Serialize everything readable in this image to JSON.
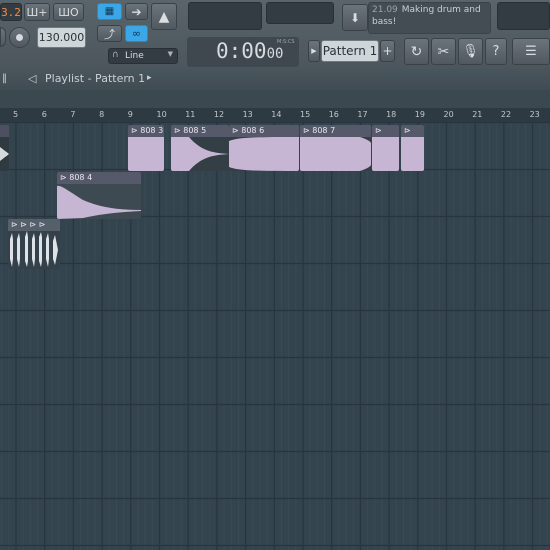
{
  "app": {
    "pattern_number_display": "3.2",
    "toolbar_buttons_left": [
      "Ш+",
      "ШО"
    ],
    "tempo": "130.000",
    "snap_mode": "Line",
    "time_display": "0:00",
    "time_display_sub": "00",
    "time_unit": "M:S:CS",
    "pattern_selector": "Pattern 1",
    "pattern_add": "+",
    "hint": {
      "time": "21.09",
      "text": "Making drum and bass!"
    }
  },
  "playlist": {
    "title": "Playlist - Pattern 1",
    "ruler_numbers": [
      "5",
      "6",
      "7",
      "8",
      "9",
      "10",
      "11",
      "12",
      "13",
      "14",
      "15",
      "16",
      "17",
      "18",
      "19",
      "20",
      "21",
      "22",
      "23"
    ],
    "clips": [
      {
        "label": "808 3"
      },
      {
        "label": "808 5"
      },
      {
        "label": "808 6"
      },
      {
        "label": "808 7"
      },
      {
        "label": ""
      },
      {
        "label": ""
      },
      {
        "label": "808 4"
      }
    ]
  },
  "colors": {
    "background": "#34444f",
    "clip_body": "#c6b6d4",
    "clip_header": "#55596a",
    "accent_blue": "#3ba7e6"
  }
}
